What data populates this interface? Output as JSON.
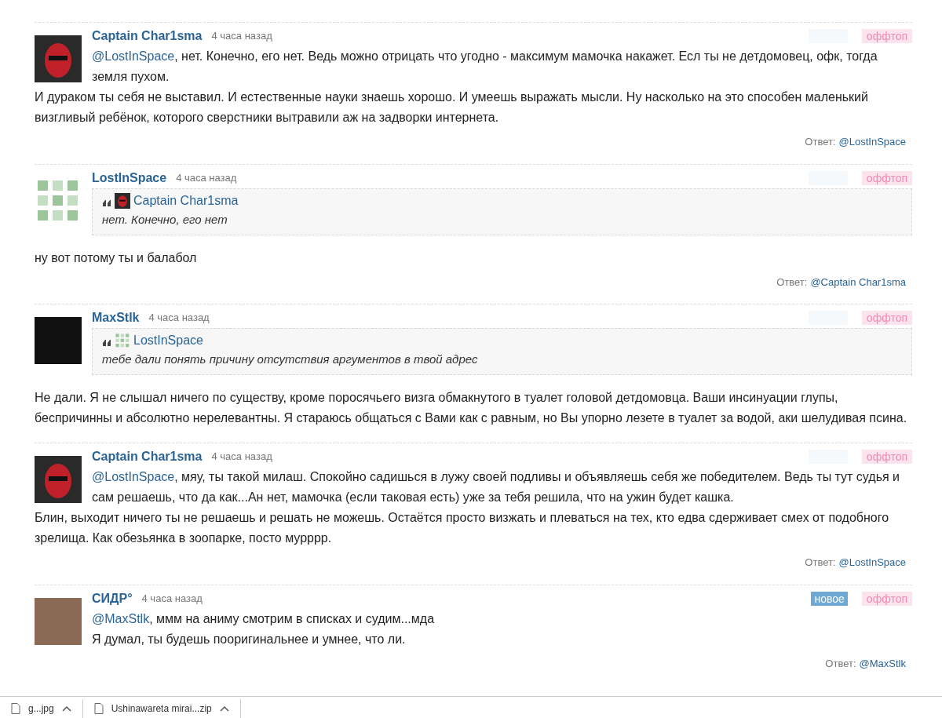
{
  "comments": [
    {
      "author": "Captain Char1sma",
      "avatar": {
        "kind": "mask"
      },
      "time": "4 часа назад",
      "new": false,
      "tag": "оффтоп",
      "paragraphs": [
        {
          "mention": "@LostInSpace",
          "text": ", нет. Конечно, его нет. Ведь можно отрицать что угодно - максимум мамочка накажет. Есл ты не детдомовец, офк, тогда земля пухом."
        },
        {
          "text": "И дураком ты себя не выставил. И естественные науки знаешь хорошо. И умеешь выражать мысли. Ну насколько на это способен маленький визгливый ребёнок, которого сверстники вытравили аж на задворки интернета."
        }
      ],
      "reply_label": "Ответ:",
      "reply_to": "@LostInSpace"
    },
    {
      "author": "LostInSpace",
      "avatar": {
        "kind": "identicon"
      },
      "time": "4 часа назад",
      "new": false,
      "tag": "оффтоп",
      "quote": {
        "author": "Captain Char1sma",
        "avatar": {
          "kind": "mask"
        },
        "text": "нет. Конечно, его нет"
      },
      "paragraphs": [
        {
          "text": "ну вот потому ты и балабол"
        }
      ],
      "reply_label": "Ответ:",
      "reply_to": "@Captain Char1sma"
    },
    {
      "author": "MaxStlk",
      "avatar": {
        "kind": "dark"
      },
      "time": "4 часа назад",
      "new": false,
      "tag": "оффтоп",
      "quote": {
        "author": "LostInSpace",
        "avatar": {
          "kind": "identicon"
        },
        "text": "тебе дали понять причину отсутствия аргументов в твой адрес"
      },
      "paragraphs": [
        {
          "text": "Не дали. Я не слышал ничего по существу, кроме поросячьего визга обмакнутого в туалет головой детдомовца. Ваши инсинуации глупы, беспричинны и абсолютно нерелевантны. Я стараюсь общаться с Вами как с равным, но Вы упорно лезете в туалет за водой, аки шелудивая псина."
        }
      ]
    },
    {
      "author": "Captain Char1sma",
      "avatar": {
        "kind": "mask"
      },
      "time": "4 часа назад",
      "new": false,
      "tag": "оффтоп",
      "paragraphs": [
        {
          "mention": "@LostInSpace",
          "text": ", мяу, ты такой милаш. Спокойно садишься в лужу своей подливы и объявляешь себя же победителем. Ведь ты тут судья и сам решаешь, что да как...Ан нет, мамочка (если таковая есть) уже за тебя решила, что на ужин будет кашка."
        },
        {
          "text": "Блин, выходит ничего ты не решаешь и решать не можешь. Остаётся просто визжать и плеваться на тех, кто едва сдерживает смех от подобного зрелища. Как обезьянка в зоопарке, посто мурррр."
        }
      ],
      "reply_label": "Ответ:",
      "reply_to": "@LostInSpace"
    },
    {
      "author": "СИДР°",
      "avatar": {
        "kind": "photo"
      },
      "time": "4 часа назад",
      "new": true,
      "new_label": "новое",
      "tag": "оффтоп",
      "paragraphs": [
        {
          "mention": "@MaxStlk",
          "text": ", ммм на аниму смотрим в списках и судим...мда"
        },
        {
          "text": "Я думал, ты будешь пооригинальнее и умнее, что ли."
        }
      ],
      "reply_label": "Ответ:",
      "reply_to": "@MaxStlk"
    }
  ],
  "downloads": [
    {
      "name": "g...jpg"
    },
    {
      "name": "Ushinawareta mirai...zip"
    }
  ]
}
